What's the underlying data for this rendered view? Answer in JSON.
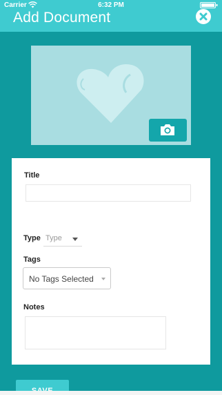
{
  "status_bar": {
    "carrier": "Carrier",
    "time": "6:32 PM"
  },
  "header": {
    "title": "Add Document",
    "close_icon": "close-x-icon"
  },
  "image_area": {
    "placeholder_icon": "heart-icon",
    "camera_icon": "camera-icon"
  },
  "form": {
    "title_label": "Title",
    "title_value": "",
    "type_label": "Type",
    "type_value": "Type",
    "tags_label": "Tags",
    "tags_value": "No Tags Selected",
    "notes_label": "Notes",
    "notes_value": ""
  },
  "actions": {
    "save_label": "SAVE"
  },
  "colors": {
    "background": "#0f9a9e",
    "header": "#3fcbd0",
    "image_area": "#a9dde1",
    "camera_button": "#14a6ab",
    "card": "#ffffff"
  }
}
